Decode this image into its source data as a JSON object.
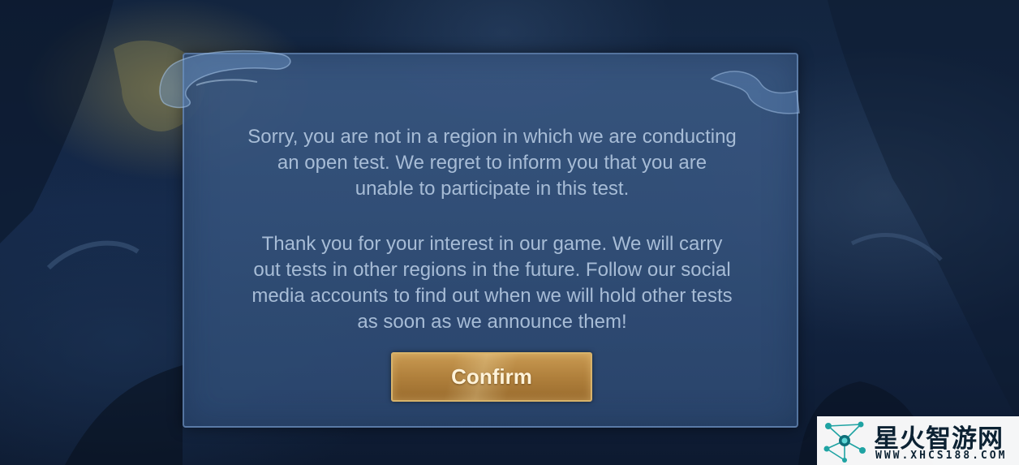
{
  "dialog": {
    "message_primary": "Sorry, you are not in a region in which we are conducting\nan open test. We regret to inform you that you are\nunable to participate in this test.",
    "message_secondary": "Thank you for your interest in our game. We will carry\nout tests in other regions in the future. Follow our social\nmedia accounts to find out when we will hold other tests\nas soon as we announce them!",
    "confirm_label": "Confirm"
  },
  "watermark": {
    "title": "星火智游网",
    "url": "WWW.XHCS188.COM"
  },
  "icons": {
    "watermark_logo": "network-nodes-icon",
    "dialog_decoration": "mist-swirl-decoration"
  },
  "colors": {
    "dialog_background": "#3a5882",
    "dialog_text": "#a7bcd6",
    "button_gold": "#b0803c",
    "button_text": "#fff3da",
    "watermark_accent": "#1fa3a3"
  }
}
